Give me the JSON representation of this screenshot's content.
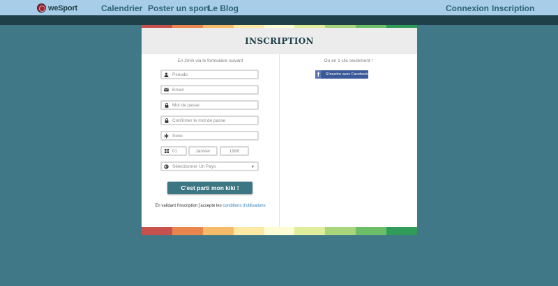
{
  "nav": {
    "logo_text": "weSport",
    "links": [
      "Calendrier",
      "Poster un sport",
      "Le Blog"
    ],
    "right_links": [
      "Connexion",
      "Inscription"
    ]
  },
  "form": {
    "title": "INSCRIPTION",
    "left_subtitle": "En 2min via le formulaire suivant",
    "right_subtitle": "Ou en 1 clic seulement !",
    "facebook_button": "S'inscrire avec Facebook",
    "facebook_letter": "f",
    "fields": {
      "pseudo": "Pseudo",
      "email": "Email",
      "password": "Mot de passe",
      "confirm_password": "Confirmer le mot de passe",
      "sexe": "Sexe",
      "birth_day": "01",
      "birth_month": "Janvier",
      "birth_year": "1980",
      "country": "Sélectionner Un Pays"
    },
    "submit_label": "C'est parti mon kiki !",
    "terms_prefix": "En validant l'inscription j'accepte les",
    "terms_link": "conditions d'utilisations"
  },
  "colors": {
    "background": "#417888",
    "nav": "#a7cde9",
    "subbar": "#1f3f49",
    "accent": "#3d7683",
    "facebook": "#3b5998",
    "stripe": [
      "#c7524d",
      "#e9864e",
      "#f6bb6a",
      "#fde9a4",
      "#fefcd4",
      "#e0ed9c",
      "#a8d47c",
      "#6cbf68",
      "#2f9c5a"
    ]
  }
}
